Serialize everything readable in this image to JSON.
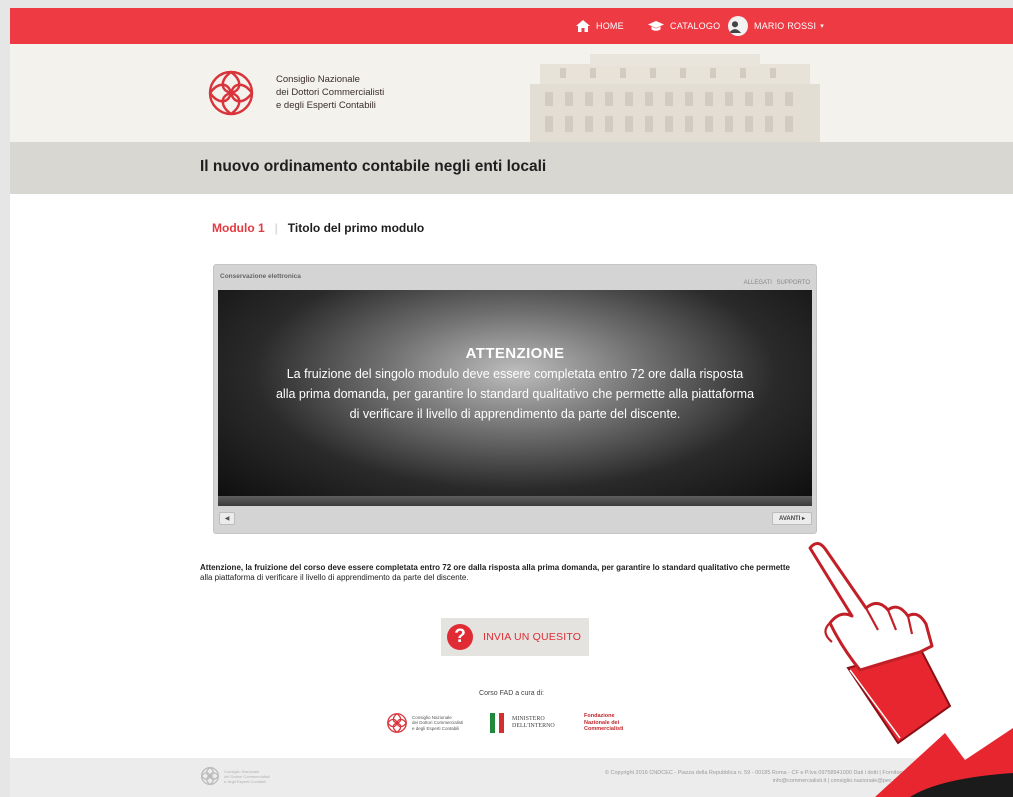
{
  "nav": {
    "home_label": "HOME",
    "catalog_label": "CATALOGO",
    "user_label": "MARIO ROSSI"
  },
  "header": {
    "org_name_lines": [
      "Consiglio Nazionale",
      "dei Dottori Commercialisti",
      "e degli Esperti Contabili"
    ]
  },
  "course": {
    "title": "Il nuovo ordinamento contabile negli enti locali"
  },
  "module": {
    "number_label": "Modulo 1",
    "separator": "|",
    "title": "Titolo del primo modulo"
  },
  "player": {
    "title": "Conservazione elettronica",
    "links": "ALLEGATI  SUPPORTO",
    "screen_title": "ATTENZIONE",
    "screen_lines": [
      "La fruizione del singolo modulo deve essere completata entro 72 ore dalla risposta",
      "alla prima domanda, per garantire lo standard qualitativo che permette alla piattaforma",
      "di verificare il livello di apprendimento da parte del discente."
    ],
    "back_symbol": "◀",
    "next_label": "AVANTI ▸"
  },
  "notice": {
    "bold_text": "Attenzione, la fruizione del corso deve essere completata entro 72 ore dalla risposta alla prima domanda, per garantire lo standard qualitativo che permette",
    "rest_text": "alla piattaforma di verificare il livello di apprendimento da parte del discente."
  },
  "ask_button": {
    "icon": "?",
    "label": "INVIA UN QUESITO"
  },
  "credits": {
    "label": "Corso FAD a cura di:",
    "partner1_lines": [
      "Consiglio Nazionale",
      "dei Dottori Commercialisti",
      "e degli Esperti Contabili"
    ],
    "partner2_lines": [
      "MINISTERO",
      "DELL'INTERNO"
    ],
    "partner3_lines": [
      "Fondazione",
      "Nazionale dei",
      "Commercialisti"
    ]
  },
  "footer": {
    "logo_lines": [
      "Consiglio Nazionale",
      "dei Dottori Commercialisti",
      "e degli Esperti Contabili"
    ],
    "copyright_line1": "© Copyright 2016 CNDCEC - Piazza della Repubblica n. 59 - 00185 Roma - CF e P.Iva 09758941000 Dati i dotti | Fornitori Note legali - Privacy",
    "copyright_line2": "info@commercialisti.it | consiglio.nazionale@pec.commercialisti.it | credits"
  },
  "colors": {
    "brand_red": "#ee3a43",
    "header_bg": "#f4f2ec",
    "title_band_bg": "#d8d7d2"
  }
}
